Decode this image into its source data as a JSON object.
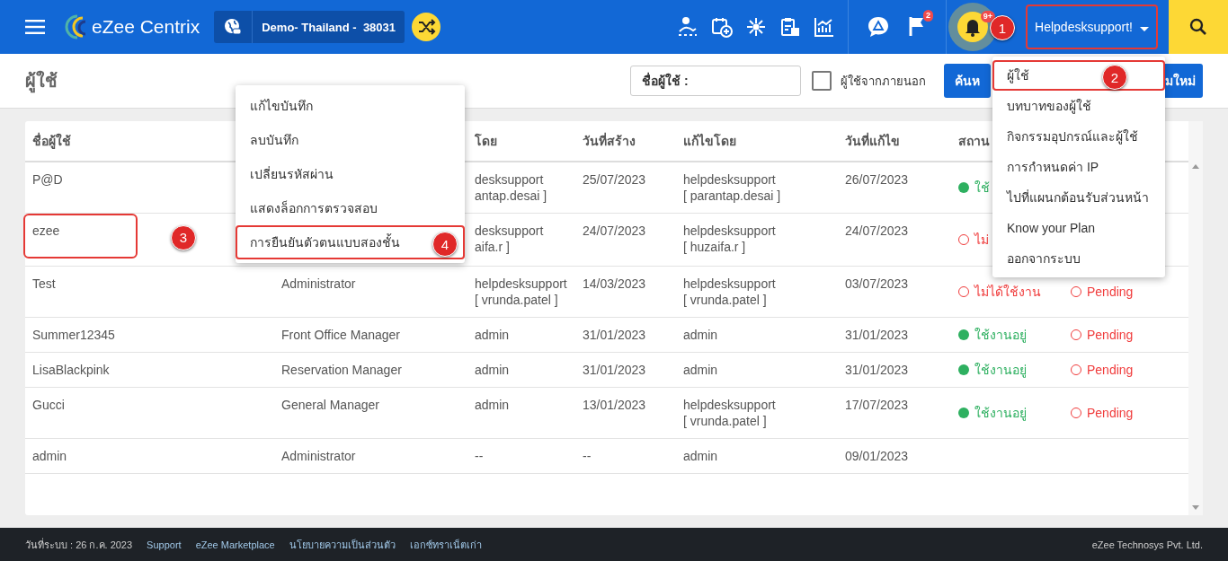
{
  "header": {
    "brand": "eZee Centrix",
    "property": "Demo- Thailand -  38031",
    "flag_count": "2",
    "bell_count": "9+",
    "user": {
      "name": "Helpdesksupport!",
      "callout": "1"
    }
  },
  "user_menu": [
    {
      "label": "ผู้ใช้",
      "selected": true,
      "callout": "2"
    },
    {
      "label": "บทบาทของผู้ใช้",
      "selected": false
    },
    {
      "label": "กิจกรรมอุปกรณ์และผู้ใช้",
      "selected": false
    },
    {
      "label": "การกำหนดค่า IP",
      "selected": false
    },
    {
      "label": "ไปที่แผนกต้อนรับส่วนหน้า",
      "selected": false
    },
    {
      "label": "Know your Plan",
      "selected": false
    },
    {
      "label": "ออกจากระบบ",
      "selected": false
    }
  ],
  "page": {
    "title": "ผู้ใช้",
    "search": {
      "placeholder": "ชื่อผู้ใช้ :"
    },
    "external": {
      "label": "ผู้ใช้จากภายนอก",
      "checked": false
    },
    "search_button": "ค้นห",
    "add_button": "มใหม่"
  },
  "context_menu": [
    {
      "label": "แก้ไขบันทึก",
      "selected": false
    },
    {
      "label": "ลบบันทึก",
      "selected": false
    },
    {
      "label": "เปลี่ยนรหัสผ่าน",
      "selected": false
    },
    {
      "label": "แสดงล็อกการตรวจสอบ",
      "selected": false
    },
    {
      "label": "การยืนยันตัวตนแบบสองชั้น",
      "selected": true,
      "callout": "4"
    }
  ],
  "table": {
    "columns": [
      "ชื่อผู้ใช้",
      "",
      "โดย",
      "วันที่สร้าง",
      "แก้ไขโดย",
      "วันที่แก้ไข",
      "สถาน",
      ""
    ],
    "rows": [
      {
        "name": "P@D",
        "role": "",
        "created_by": "desksupport\nantap.desai ]",
        "created": "25/07/2023",
        "modified_by": "helpdesksupport\n[ parantap.desai ]",
        "modified": "26/07/2023",
        "status": {
          "active": true,
          "text": "ใช้"
        }
      },
      {
        "name": "ezee",
        "callout": "3",
        "role": "",
        "created_by": "desksupport\naifa.r ]",
        "created": "24/07/2023",
        "modified_by": "helpdesksupport\n[ huzaifa.r ]",
        "modified": "24/07/2023",
        "status": {
          "active": false,
          "text": "ไม่"
        }
      },
      {
        "name": "Test",
        "role": "Administrator",
        "created_by": "helpdesksupport\n[ vrunda.patel ]",
        "created": "14/03/2023",
        "modified_by": "helpdesksupport\n[ vrunda.patel ]",
        "modified": "03/07/2023",
        "status": {
          "active": false,
          "text": "ไม่ได้ใช้งาน"
        },
        "tfa": {
          "enabled": false,
          "text": "Pending"
        }
      },
      {
        "name": "Summer12345",
        "role": "Front Office Manager",
        "created_by": "admin",
        "created": "31/01/2023",
        "modified_by": "admin",
        "modified": "31/01/2023",
        "status": {
          "active": true,
          "text": "ใช้งานอยู่"
        },
        "tfa": {
          "enabled": false,
          "text": "Pending"
        }
      },
      {
        "name": "LisaBlackpink",
        "role": "Reservation Manager",
        "created_by": "admin",
        "created": "31/01/2023",
        "modified_by": "admin",
        "modified": "31/01/2023",
        "status": {
          "active": true,
          "text": "ใช้งานอยู่"
        },
        "tfa": {
          "enabled": false,
          "text": "Pending"
        }
      },
      {
        "name": "Gucci",
        "role": "General Manager",
        "created_by": "admin",
        "created": "13/01/2023",
        "modified_by": "helpdesksupport\n[ vrunda.patel ]",
        "modified": "17/07/2023",
        "status": {
          "active": true,
          "text": "ใช้งานอยู่"
        },
        "tfa": {
          "enabled": false,
          "text": "Pending"
        }
      },
      {
        "name": "admin",
        "role": "Administrator",
        "created_by": "--",
        "created": "--",
        "modified_by": "admin",
        "modified": "09/01/2023"
      }
    ]
  },
  "footer": {
    "system_date": "วันที่ระบบ : 26 ก.ค. 2023",
    "links": [
      "Support",
      "eZee Marketplace",
      "นโยบายความเป็นส่วนตัว",
      "เอกซ์ทราเน็ตเก่า"
    ],
    "company": "eZee Technosys Pvt. Ltd."
  }
}
